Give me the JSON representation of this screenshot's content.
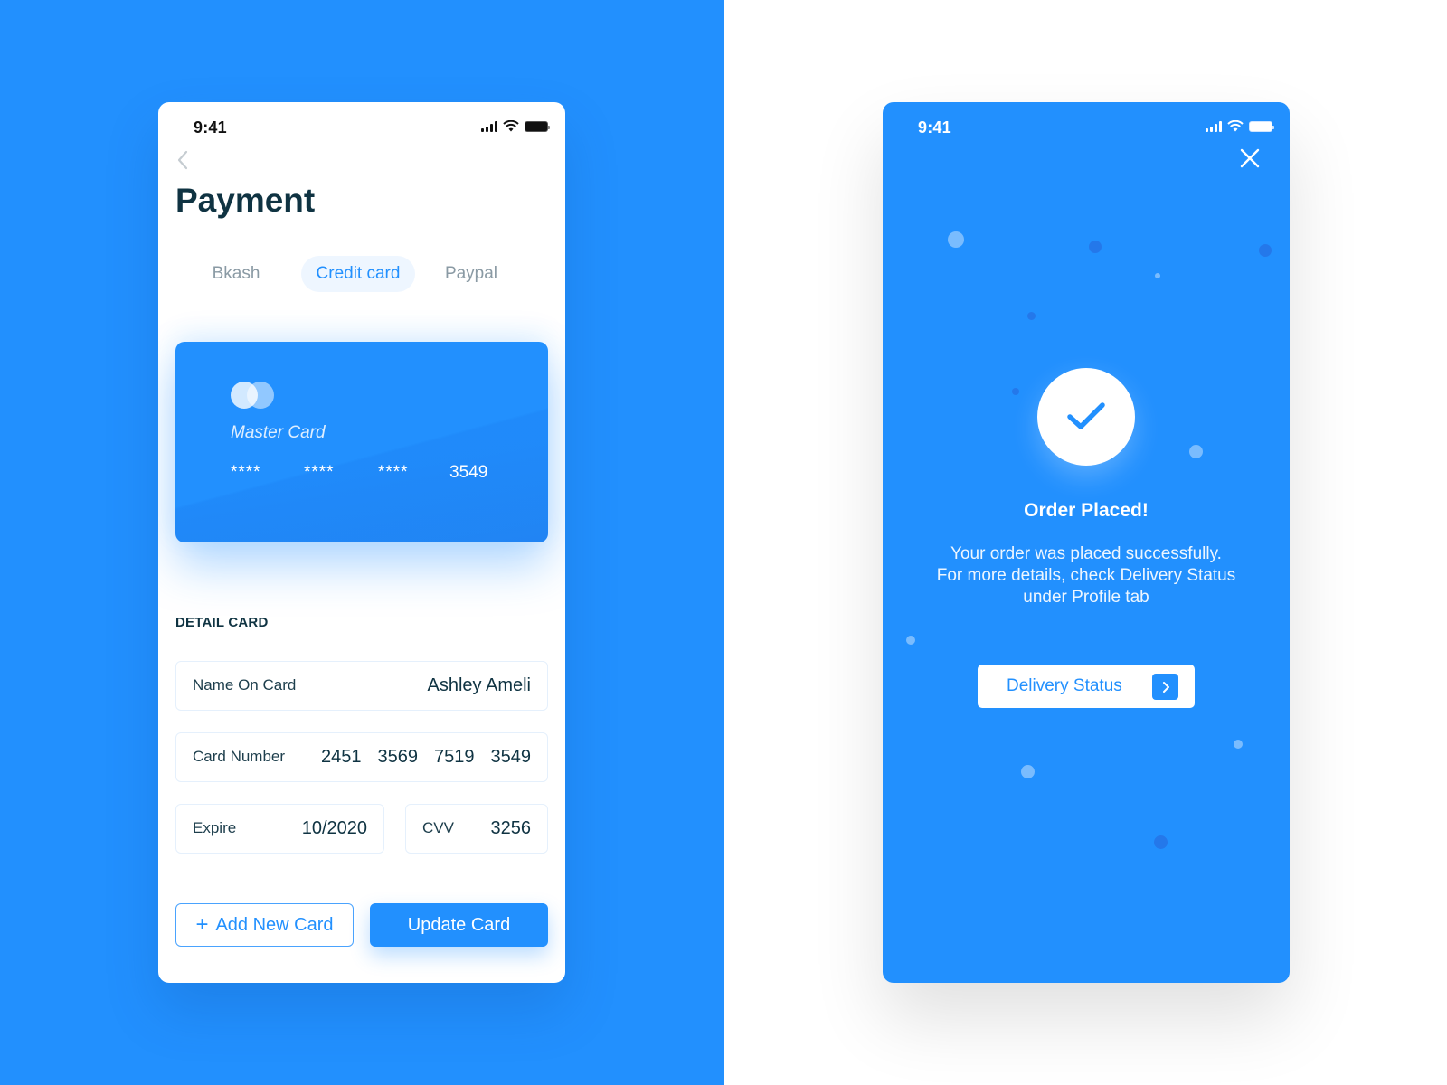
{
  "colors": {
    "brand_blue": "#2290fe",
    "dark_text": "#0f3342",
    "muted_text": "#8a9aa4"
  },
  "payment_screen": {
    "status_bar": {
      "time": "9:41"
    },
    "title": "Payment",
    "tabs": [
      {
        "label": "Bkash",
        "active": false
      },
      {
        "label": "Credit card",
        "active": true
      },
      {
        "label": "Paypal",
        "active": false
      }
    ],
    "card": {
      "brand": "Master Card",
      "number_groups": [
        "****",
        "****",
        "****",
        "3549"
      ]
    },
    "detail_section_label": "DETAIL CARD",
    "fields": {
      "name": {
        "label": "Name On Card",
        "value": "Ashley Ameli"
      },
      "number": {
        "label": "Card Number",
        "groups": [
          "2451",
          "3569",
          "7519",
          "3549"
        ]
      },
      "expire": {
        "label": "Expire",
        "value": "10/2020"
      },
      "cvv": {
        "label": "CVV",
        "value": "3256"
      }
    },
    "buttons": {
      "add": "Add New Card",
      "add_icon": "+",
      "update": "Update Card"
    }
  },
  "success_screen": {
    "status_bar": {
      "time": "9:41"
    },
    "title": "Order Placed!",
    "message_lines": [
      "Your order was placed successfully.",
      "For more details, check Delivery Status",
      "under Profile tab"
    ],
    "button": "Delivery Status"
  }
}
